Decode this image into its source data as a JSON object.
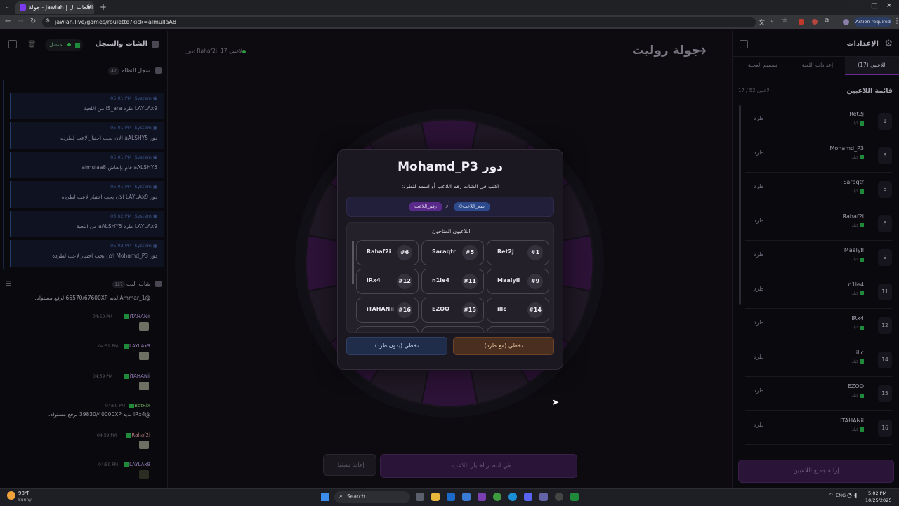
{
  "browser": {
    "tab_title": "جولة - Jawlah | منصة الألعاب ال...",
    "url": "jawlah.live/games/roulette?kick=almullaA8",
    "action_required": "Action required"
  },
  "left_panel": {
    "title": "الشات والسجل",
    "connection_status": "متصل",
    "system_log": {
      "title": "سجل النظام",
      "count": "47",
      "messages": [
        {
          "sender": "System",
          "time": "05:01 PM",
          "text": "LAYLAx9 طرد iS_ara من اللعبة"
        },
        {
          "sender": "System",
          "time": "05:01 PM",
          "text": "دور aALSHY5 الان يجب اختيار لاعب لطرده"
        },
        {
          "sender": "System",
          "time": "05:01 PM",
          "text": "aALSHY5 قام بإنعاش almulaa8"
        },
        {
          "sender": "System",
          "time": "05:01 PM",
          "text": "دور LAYLAx9 الان يجب اختيار لاعب لطرده"
        },
        {
          "sender": "System",
          "time": "05:02 PM",
          "text": "LAYLAx9 طرد aALSHY5 من اللعبة"
        },
        {
          "sender": "System",
          "time": "05:02 PM",
          "text": "دور Mohamd_P3 الان يجب اختيار لاعب لطرده"
        }
      ]
    },
    "live_chat": {
      "title": "شات البث",
      "count": "127",
      "messages": [
        {
          "user": "",
          "time": "",
          "text": "@Ammar_1 لديه 66570/67600XP لرفع مستواه."
        },
        {
          "user": "iTAHANii",
          "time": "04:59 PM",
          "text": ""
        },
        {
          "user": "LAYLAx9",
          "time": "04:59 PM",
          "text": ""
        },
        {
          "user": "iTAHANii",
          "time": "04:59 PM",
          "text": ""
        },
        {
          "user": "BotRix",
          "time": "04:59 PM",
          "text": "@lRx4 لديه 39830/40000XP لرفع مستواه."
        },
        {
          "user": "Rahaf2i",
          "time": "04:59 PM",
          "text": ""
        },
        {
          "user": "LAYLAx9",
          "time": "04:59 PM",
          "text": ""
        }
      ]
    }
  },
  "center": {
    "title": "جولة روليت",
    "players_count": "17 لاعبين",
    "current_turn": "دور: Rahaf2i",
    "restart_button": "إعادة تشغيل",
    "waiting_button": "في انتظار اختيار اللاعب...",
    "modal": {
      "title": "دور Mohamd_P3",
      "instruction": "اكتب في الشات رقم اللاعب أو اسمه للطرد:",
      "option_name": "@اسم_اللاعب",
      "option_or": "أو",
      "option_number": "رقم_اللاعب",
      "available_label": "اللاعبون المتاحون:",
      "players": [
        {
          "name": "Ret2j",
          "num": "#1"
        },
        {
          "name": "Saraqtr",
          "num": "#5"
        },
        {
          "name": "Rahaf2i",
          "num": "#6"
        },
        {
          "name": "Maalyll",
          "num": "#9"
        },
        {
          "name": "n1le4",
          "num": "#11"
        },
        {
          "name": "lRx4",
          "num": "#12"
        },
        {
          "name": "illc",
          "num": "#14"
        },
        {
          "name": "EZOO",
          "num": "#15"
        },
        {
          "name": "iTAHANii",
          "num": "#16"
        }
      ],
      "skip_with_kick": "تخطي (مع طرد)",
      "skip_without_kick": "تخطي (بدون طرد)"
    }
  },
  "right_panel": {
    "title": "الإعدادات",
    "tabs": [
      "اللاعبين (17)",
      "إعدادات اللعبة",
      "تصميم العجلة"
    ],
    "list_title": "قائمة اللاعبين",
    "list_count": "17 / 52 لاعبين",
    "kick_label": "طرد",
    "status_label": "كيك",
    "players": [
      {
        "idx": "1",
        "name": "Ret2j"
      },
      {
        "idx": "3",
        "name": "Mohamd_P3"
      },
      {
        "idx": "5",
        "name": "Saraqtr"
      },
      {
        "idx": "6",
        "name": "Rahaf2i"
      },
      {
        "idx": "9",
        "name": "Maalyll"
      },
      {
        "idx": "11",
        "name": "n1le4"
      },
      {
        "idx": "12",
        "name": "lRx4"
      },
      {
        "idx": "14",
        "name": "illc"
      },
      {
        "idx": "15",
        "name": "EZOO"
      },
      {
        "idx": "16",
        "name": "iTAHANii"
      }
    ],
    "remove_all_button": "إزالة جميع اللاعبين"
  },
  "taskbar": {
    "temperature": "98°F",
    "weather": "Sunny",
    "search_placeholder": "Search",
    "language": "ENG",
    "time": "5:02 PM",
    "date": "10/25/2025"
  },
  "colors": {
    "accent_purple": "#6d2a9a",
    "kick_orange": "#d08a40",
    "badge_green": "#1f8b3a"
  }
}
